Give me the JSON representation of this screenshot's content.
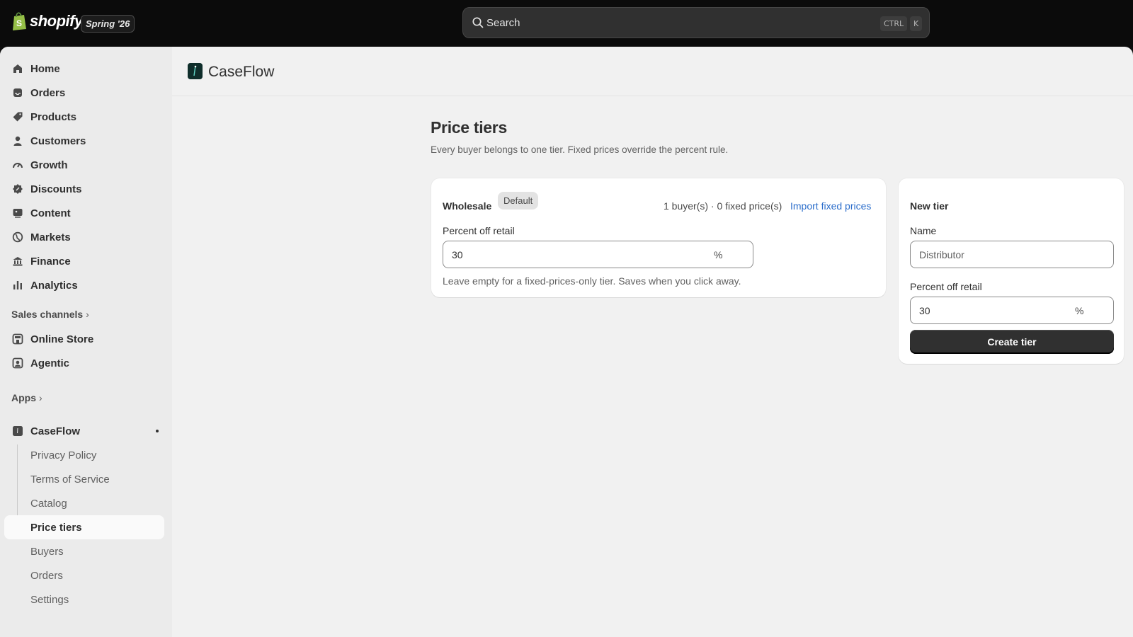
{
  "topbar": {
    "brand": "shopify",
    "edition": "Spring '26",
    "search_placeholder": "Search",
    "shortcut_mod": "CTRL",
    "shortcut_key": "K"
  },
  "sidebar": {
    "items": [
      {
        "label": "Home",
        "icon": "home-icon"
      },
      {
        "label": "Orders",
        "icon": "inbox-icon"
      },
      {
        "label": "Products",
        "icon": "tag-icon"
      },
      {
        "label": "Customers",
        "icon": "person-icon"
      },
      {
        "label": "Growth",
        "icon": "gauge-icon"
      },
      {
        "label": "Discounts",
        "icon": "discount-icon"
      },
      {
        "label": "Content",
        "icon": "content-icon"
      },
      {
        "label": "Markets",
        "icon": "globe-icon"
      },
      {
        "label": "Finance",
        "icon": "bank-icon"
      },
      {
        "label": "Analytics",
        "icon": "bar-chart-icon"
      }
    ],
    "sales_channels_label": "Sales channels",
    "channels": [
      {
        "label": "Online Store",
        "icon": "store-icon"
      },
      {
        "label": "Agentic",
        "icon": "agentic-icon"
      }
    ],
    "apps_label": "Apps",
    "app": {
      "label": "CaseFlow",
      "icon": "caseflow-app-icon"
    },
    "app_pages": [
      {
        "label": "Privacy Policy",
        "active": false
      },
      {
        "label": "Terms of Service",
        "active": false
      },
      {
        "label": "Catalog",
        "active": false
      },
      {
        "label": "Price tiers",
        "active": true
      },
      {
        "label": "Buyers",
        "active": false
      },
      {
        "label": "Orders",
        "active": false
      },
      {
        "label": "Settings",
        "active": false
      }
    ]
  },
  "app_header": {
    "name": "CaseFlow"
  },
  "page": {
    "title": "Price tiers",
    "subtitle": "Every buyer belongs to one tier. Fixed prices override the percent rule."
  },
  "tier_card": {
    "name": "Wholesale",
    "badge": "Default",
    "meta": "1 buyer(s) · 0 fixed price(s)",
    "import_link": "Import fixed prices",
    "percent_label": "Percent off retail",
    "percent_value": "30",
    "percent_suffix": "%",
    "help_text": "Leave empty for a fixed-prices-only tier. Saves when you click away."
  },
  "new_tier": {
    "title": "New tier",
    "name_label": "Name",
    "name_placeholder": "Distributor",
    "percent_label": "Percent off retail",
    "percent_value": "30",
    "percent_suffix": "%",
    "create_label": "Create tier"
  },
  "colors": {
    "topbar_bg": "#0b0b0b",
    "surface": "#f1f1f1",
    "sidebar_bg": "#ebebeb",
    "primary_button": "#303030",
    "link": "#2c6ecb"
  }
}
